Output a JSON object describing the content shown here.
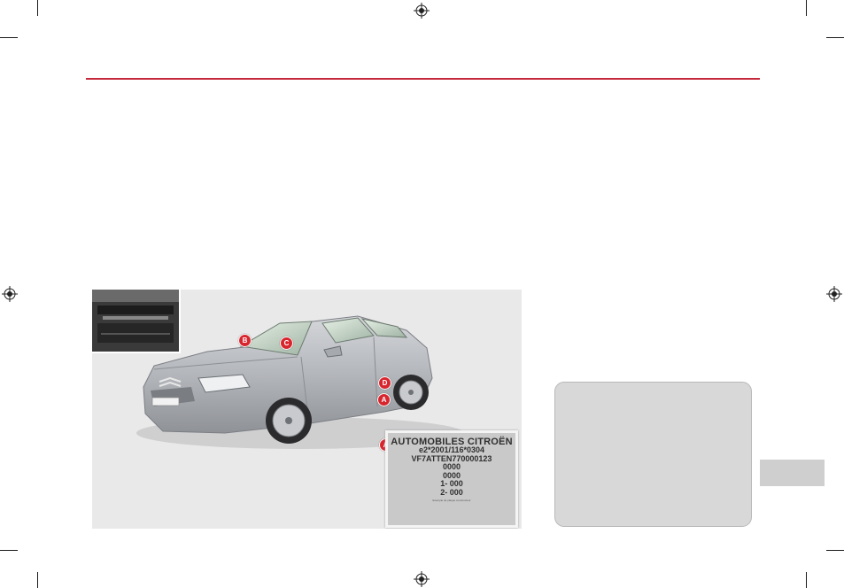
{
  "figure": {
    "markers": [
      "B",
      "C",
      "D",
      "A"
    ],
    "plate": {
      "marker": "A",
      "manufacturer": "AUTOMOBILES CITROËN",
      "approval_number": "e2*2001/116*0304",
      "vin": "VF7ATTEN770000123",
      "rows": [
        "0000",
        "0000",
        "1- 000",
        "2- 000"
      ],
      "fine_print": "Exemple de plaque constructeur"
    }
  },
  "colors": {
    "rule": "#c4283a",
    "marker": "#d8262f",
    "note_box": "#d8d8d8",
    "section_tab": "#cfcfcf"
  },
  "icons": [
    "crosshair-registration-mark"
  ]
}
